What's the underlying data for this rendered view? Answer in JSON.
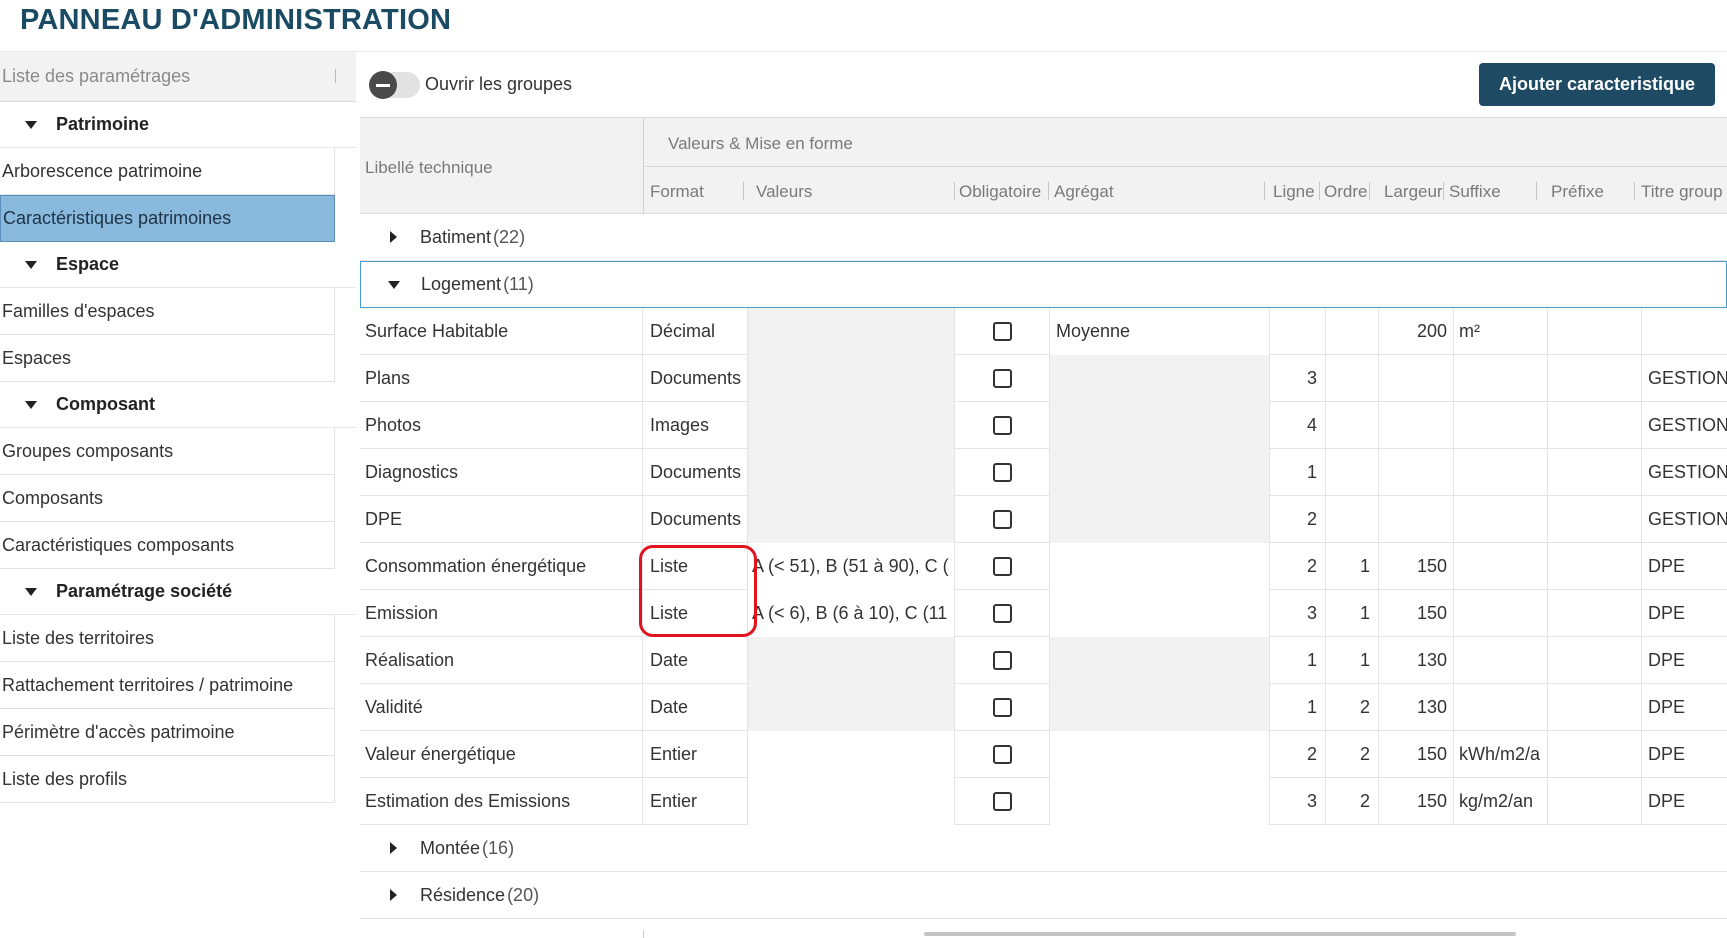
{
  "page_title": "PANNEAU D'ADMINISTRATION",
  "sidebar": {
    "search_placeholder": "Liste des paramétrages",
    "sections": [
      {
        "label": "Patrimoine",
        "items": [
          {
            "label": "Arborescence patrimoine",
            "active": false
          },
          {
            "label": "Caractéristiques patrimoines",
            "active": true
          }
        ]
      },
      {
        "label": "Espace",
        "items": [
          {
            "label": "Familles d'espaces"
          },
          {
            "label": "Espaces"
          }
        ]
      },
      {
        "label": "Composant",
        "items": [
          {
            "label": "Groupes composants"
          },
          {
            "label": "Composants"
          },
          {
            "label": "Caractéristiques composants"
          }
        ]
      },
      {
        "label": "Paramétrage société",
        "items": [
          {
            "label": "Liste des territoires"
          },
          {
            "label": "Rattachement territoires / patrimoine"
          },
          {
            "label": "Périmètre d'accès patrimoine"
          },
          {
            "label": "Liste des profils"
          }
        ]
      }
    ]
  },
  "toolbar": {
    "toggle_label": "Ouvrir les groupes",
    "add_button": "Ajouter caracteristique"
  },
  "grid": {
    "header": {
      "libelle": "Libellé technique",
      "group": "Valeurs & Mise en forme",
      "columns": [
        "Format",
        "Valeurs",
        "Obligatoire",
        "Agrégat",
        "Ligne",
        "Ordre",
        "Largeur",
        "Suffixe",
        "Préfixe",
        "Titre group"
      ]
    },
    "groups_before": [
      {
        "label": "Batiment",
        "count": "(22)"
      }
    ],
    "expanded_group": {
      "label": "Logement",
      "count": "(11)"
    },
    "rows": [
      {
        "libelle": "Surface Habitable",
        "format": "Décimal",
        "valeurs": "",
        "agregat": "Moyenne",
        "ligne": "",
        "ordre": "",
        "largeur": "200",
        "suffixe": "m²",
        "prefixe": "",
        "titre": ""
      },
      {
        "libelle": "Plans",
        "format": "Documents",
        "valeurs": "",
        "agregat": "",
        "ligne": "3",
        "ordre": "",
        "largeur": "",
        "suffixe": "",
        "prefixe": "",
        "titre": "GESTION D"
      },
      {
        "libelle": "Photos",
        "format": "Images",
        "valeurs": "",
        "agregat": "",
        "ligne": "4",
        "ordre": "",
        "largeur": "",
        "suffixe": "",
        "prefixe": "",
        "titre": "GESTION D"
      },
      {
        "libelle": "Diagnostics",
        "format": "Documents",
        "valeurs": "",
        "agregat": "",
        "ligne": "1",
        "ordre": "",
        "largeur": "",
        "suffixe": "",
        "prefixe": "",
        "titre": "GESTION D"
      },
      {
        "libelle": "DPE",
        "format": "Documents",
        "valeurs": "",
        "agregat": "",
        "ligne": "2",
        "ordre": "",
        "largeur": "",
        "suffixe": "",
        "prefixe": "",
        "titre": "GESTION D"
      },
      {
        "libelle": "Consommation énergétique",
        "format": "Liste",
        "valeurs": "A (< 51), B (51 à 90), C (",
        "agregat": "",
        "ligne": "2",
        "ordre": "1",
        "largeur": "150",
        "suffixe": "",
        "prefixe": "",
        "titre": "DPE"
      },
      {
        "libelle": "Emission",
        "format": "Liste",
        "valeurs": "A (< 6), B (6 à 10), C (11",
        "agregat": "",
        "ligne": "3",
        "ordre": "1",
        "largeur": "150",
        "suffixe": "",
        "prefixe": "",
        "titre": "DPE"
      },
      {
        "libelle": "Réalisation",
        "format": "Date",
        "valeurs": "",
        "agregat": "",
        "ligne": "1",
        "ordre": "1",
        "largeur": "130",
        "suffixe": "",
        "prefixe": "",
        "titre": "DPE"
      },
      {
        "libelle": "Validité",
        "format": "Date",
        "valeurs": "",
        "agregat": "",
        "ligne": "1",
        "ordre": "2",
        "largeur": "130",
        "suffixe": "",
        "prefixe": "",
        "titre": "DPE"
      },
      {
        "libelle": "Valeur énergétique",
        "format": "Entier",
        "valeurs": "",
        "agregat": "",
        "ligne": "2",
        "ordre": "2",
        "largeur": "150",
        "suffixe": "kWh/m2/a",
        "prefixe": "",
        "titre": "DPE"
      },
      {
        "libelle": "Estimation des Emissions",
        "format": "Entier",
        "valeurs": "",
        "agregat": "",
        "ligne": "3",
        "ordre": "2",
        "largeur": "150",
        "suffixe": "kg/m2/an",
        "prefixe": "",
        "titre": "DPE"
      }
    ],
    "groups_after": [
      {
        "label": "Montée",
        "count": "(16)"
      },
      {
        "label": "Résidence",
        "count": "(20)"
      }
    ]
  },
  "colors": {
    "brand": "#1e4a63",
    "active_item": "#89b9dd",
    "highlight": "#e0141e"
  }
}
